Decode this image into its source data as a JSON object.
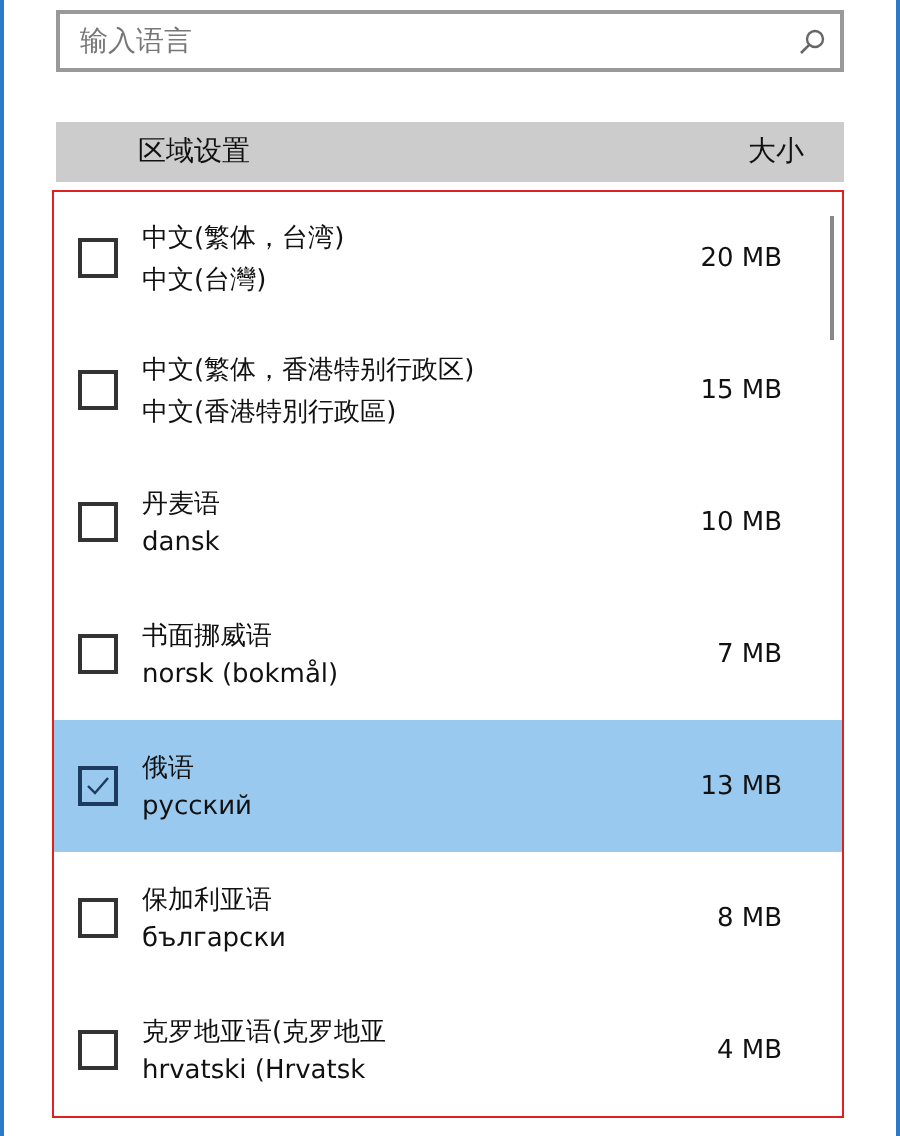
{
  "search": {
    "placeholder": "输入语言"
  },
  "table": {
    "columns": [
      "区域设置",
      "大小"
    ],
    "rows": [
      {
        "name": "中文(繁体，台湾)",
        "native": "中文(台灣)",
        "size": "20 MB",
        "checked": false,
        "selected": false
      },
      {
        "name": "中文(繁体，香港特别行政区)",
        "native": "中文(香港特別行政區)",
        "size": "15 MB",
        "checked": false,
        "selected": false
      },
      {
        "name": "丹麦语",
        "native": "dansk",
        "size": "10 MB",
        "checked": false,
        "selected": false
      },
      {
        "name": "书面挪威语",
        "native": "norsk (bokmål)",
        "size": "7 MB",
        "checked": false,
        "selected": false
      },
      {
        "name": "俄语",
        "native": "русский",
        "size": "13 MB",
        "checked": true,
        "selected": true
      },
      {
        "name": "保加利亚语",
        "native": "български",
        "size": "8 MB",
        "checked": false,
        "selected": false
      },
      {
        "name": "克罗地亚语(克罗地亚",
        "native": "hrvatski (Hrvatsk",
        "size": "4 MB",
        "checked": false,
        "selected": false
      }
    ]
  }
}
